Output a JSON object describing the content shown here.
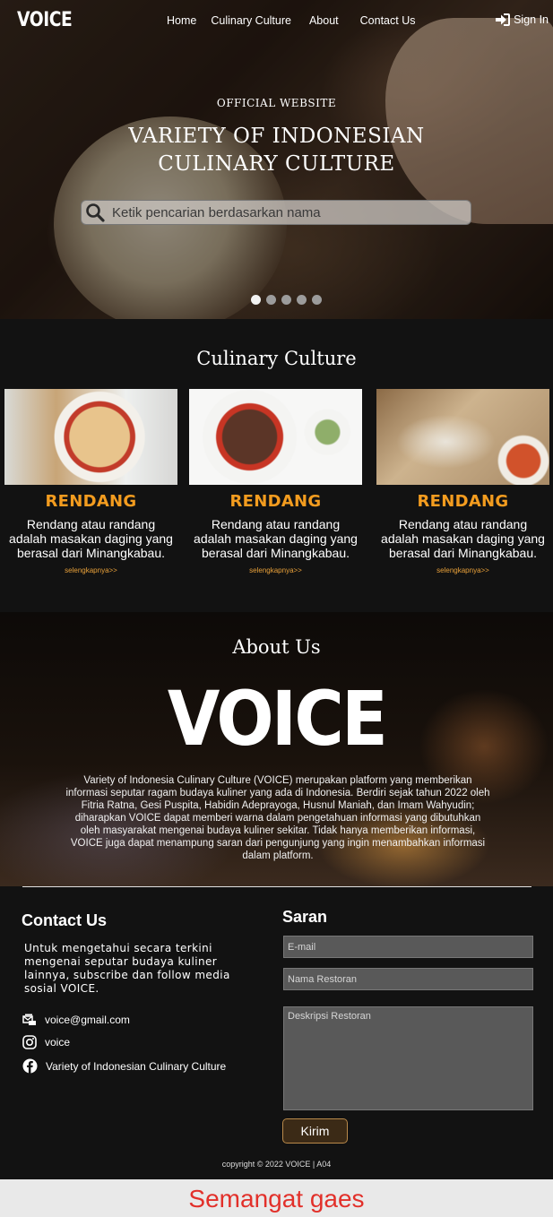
{
  "header": {
    "logo": "VOICE",
    "nav": [
      "Home",
      "Culinary Culture",
      "About",
      "Contact Us"
    ],
    "signin_label": "Sign In"
  },
  "hero": {
    "subtitle": "OFFICIAL WEBSITE",
    "title_line1": "VARIETY OF INDONESIAN",
    "title_line2": "CULINARY CULTURE",
    "search_placeholder": "Ketik pencarian berdasarkan nama",
    "slide_count": 5,
    "active_slide": 1
  },
  "culinary": {
    "title": "Culinary Culture",
    "cards": [
      {
        "name": "RENDANG",
        "desc": "Rendang atau randang adalah masakan daging yang berasal dari Minangkabau.",
        "more": "selengkapnya>>"
      },
      {
        "name": "RENDANG",
        "desc": "Rendang atau randang adalah masakan daging yang berasal dari Minangkabau.",
        "more": "selengkapnya>>"
      },
      {
        "name": "RENDANG",
        "desc": "Rendang atau randang adalah masakan daging yang berasal dari Minangkabau.",
        "more": "selengkapnya>>"
      }
    ]
  },
  "about": {
    "title": "About Us",
    "brand": "VOICE",
    "text": "Variety of Indonesia Culinary Culture (VOICE) merupakan platform yang memberikan informasi seputar ragam budaya kuliner yang ada di Indonesia. Berdiri sejak tahun 2022 oleh Fitria Ratna, Gesi Puspita, Habidin Adeprayoga, Husnul Maniah, dan Imam Wahyudin; diharapkan VOICE dapat memberi warna dalam pengetahuan informasi yang dibutuhkan oleh masyarakat mengenai budaya kuliner sekitar. Tidak hanya memberikan informasi, VOICE juga dapat menampung saran dari pengunjung yang ingin menambahkan informasi dalam platform."
  },
  "contact": {
    "title": "Contact Us",
    "text": "Untuk mengetahui secara terkini mengenai  seputar budaya kuliner lainnya, subscribe dan follow media sosial VOICE.",
    "email": "voice@gmail.com",
    "instagram": "voice",
    "facebook": "Variety of Indonesian Culinary Culture"
  },
  "saran": {
    "title": "Saran",
    "email_placeholder": "E-mail",
    "restaurant_placeholder": "Nama Restoran",
    "description_placeholder": "Deskripsi Restoran",
    "submit_label": "Kirim"
  },
  "copyright": "copyright © 2022 VOICE | A04",
  "footer_banner": "Semangat gaes",
  "colors": {
    "accent": "#f39c1f",
    "banner_text": "#e2302a",
    "background": "#121212"
  }
}
